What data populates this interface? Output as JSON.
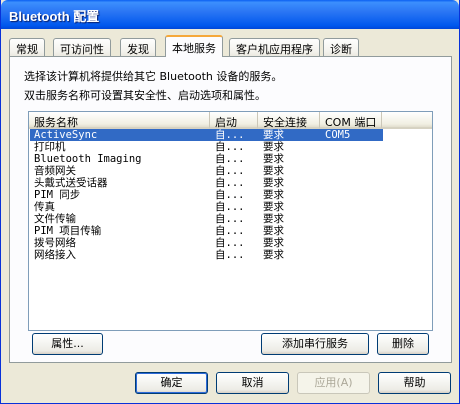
{
  "window": {
    "title": "Bluetooth 配置"
  },
  "tabs": [
    {
      "label": "常规"
    },
    {
      "label": "可访问性"
    },
    {
      "label": "发现"
    },
    {
      "label": "本地服务"
    },
    {
      "label": "客户机应用程序"
    },
    {
      "label": "诊断"
    }
  ],
  "panel": {
    "description_line1": "选择该计算机将提供给其它 Bluetooth 设备的服务。",
    "description_line2": "双击服务名称可设置其安全性、启动选项和属性。"
  },
  "services": {
    "columns": [
      "服务名称",
      "启动",
      "安全连接",
      "COM 端口"
    ],
    "rows": [
      {
        "name": "ActiveSync",
        "startup": "自...",
        "security": "要求",
        "port": "COM5",
        "selected": true
      },
      {
        "name": "打印机",
        "startup": "自...",
        "security": "要求",
        "port": ""
      },
      {
        "name": "Bluetooth Imaging",
        "startup": "自...",
        "security": "要求",
        "port": ""
      },
      {
        "name": "音频网关",
        "startup": "自...",
        "security": "要求",
        "port": ""
      },
      {
        "name": "头戴式送受话器",
        "startup": "自...",
        "security": "要求",
        "port": ""
      },
      {
        "name": "PIM 同步",
        "startup": "自...",
        "security": "要求",
        "port": ""
      },
      {
        "name": "传真",
        "startup": "自...",
        "security": "要求",
        "port": ""
      },
      {
        "name": "文件传输",
        "startup": "自...",
        "security": "要求",
        "port": ""
      },
      {
        "name": "PIM 项目传输",
        "startup": "自...",
        "security": "要求",
        "port": ""
      },
      {
        "name": "拨号网络",
        "startup": "自...",
        "security": "要求",
        "port": ""
      },
      {
        "name": "网络接入",
        "startup": "自...",
        "security": "要求",
        "port": ""
      }
    ]
  },
  "buttons": {
    "properties": "属性...",
    "add_serial": "添加串行服务",
    "delete": "删除",
    "ok": "确定",
    "cancel": "取消",
    "apply": "应用(A)",
    "help": "帮助"
  },
  "colors": {
    "titlebar": "#0058ee",
    "selection": "#316ac5",
    "active_tab_accent": "#f5a83a"
  }
}
